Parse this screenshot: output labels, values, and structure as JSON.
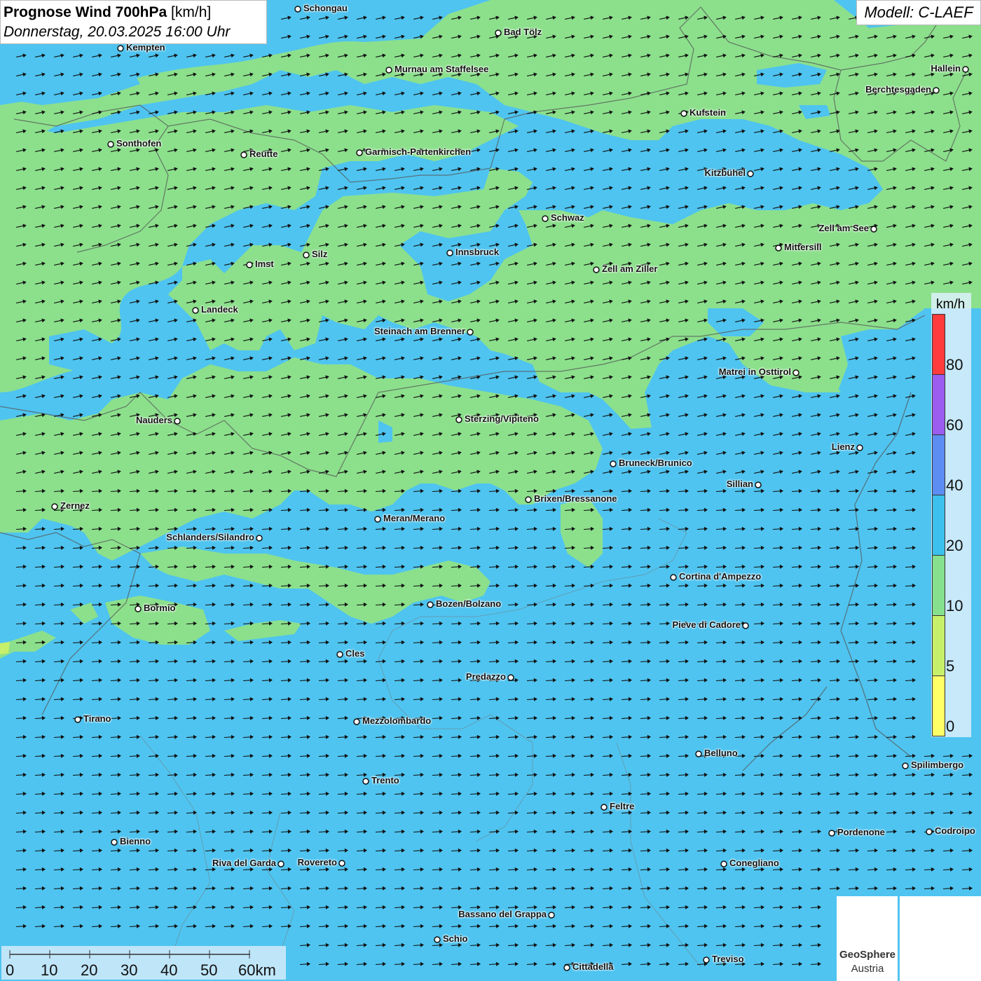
{
  "header": {
    "title_bold": "Prognose Wind 700hPa",
    "title_unit": "[km/h]",
    "datetime": "Donnerstag, 20.03.2025 16:00 Uhr",
    "model": "Modell: C-LAEF"
  },
  "legend": {
    "unit": "km/h",
    "ticks": [
      "80",
      "60",
      "40",
      "20",
      "10",
      "5",
      "0"
    ],
    "colors": {
      "above_80": "#ff3b3b",
      "60_80": "#9b5cf0",
      "40_60": "#5b8df2",
      "20_40": "#3cc0ec",
      "10_20": "#86e08e",
      "5_10": "#c6f06a",
      "0_5": "#ffff66"
    }
  },
  "scalebar": {
    "ticks": [
      "0",
      "10",
      "20",
      "30",
      "40",
      "50",
      "60km"
    ]
  },
  "logo": {
    "name": "GeoSphere",
    "subtitle": "Austria",
    "icon": "geosphere-logo-icon",
    "second_icon": "cloud-arrow-icon"
  },
  "cities": [
    {
      "name": "Schongau"
    },
    {
      "name": "Bad Tölz"
    },
    {
      "name": "Kempten"
    },
    {
      "name": "Murnau am Staffelsee"
    },
    {
      "name": "Hallein"
    },
    {
      "name": "Berchtesgaden"
    },
    {
      "name": "Kufstein"
    },
    {
      "name": "Sonthofen"
    },
    {
      "name": "Reutte"
    },
    {
      "name": "Garmisch-Partenkirchen"
    },
    {
      "name": "Kitzbühel"
    },
    {
      "name": "Schwaz"
    },
    {
      "name": "Zell am See"
    },
    {
      "name": "Mittersill"
    },
    {
      "name": "Innsbruck"
    },
    {
      "name": "Imst"
    },
    {
      "name": "Silz"
    },
    {
      "name": "Zell am Ziller"
    },
    {
      "name": "Landeck"
    },
    {
      "name": "Steinach am Brenner"
    },
    {
      "name": "Matrei in Osttirol"
    },
    {
      "name": "Nauders"
    },
    {
      "name": "Sterzing/Vipiteno"
    },
    {
      "name": "Lienz"
    },
    {
      "name": "Bruneck/Brunico"
    },
    {
      "name": "Sillian"
    },
    {
      "name": "Zernez"
    },
    {
      "name": "Brixen/Bressanone"
    },
    {
      "name": "Meran/Merano"
    },
    {
      "name": "Schlanders/Silandro"
    },
    {
      "name": "Cortina d'Ampezzo"
    },
    {
      "name": "Bozen/Bolzano"
    },
    {
      "name": "Bormio"
    },
    {
      "name": "Pieve di Cadore"
    },
    {
      "name": "Cles"
    },
    {
      "name": "Predazzo"
    },
    {
      "name": "Tirano"
    },
    {
      "name": "Mezzolombardo"
    },
    {
      "name": "Belluno"
    },
    {
      "name": "Spilimbergo"
    },
    {
      "name": "Trento"
    },
    {
      "name": "Feltre"
    },
    {
      "name": "Pordenone"
    },
    {
      "name": "Codroipo"
    },
    {
      "name": "Bienno"
    },
    {
      "name": "Riva del Garda"
    },
    {
      "name": "Rovereto"
    },
    {
      "name": "Conegliano"
    },
    {
      "name": "Bassano del Grappa"
    },
    {
      "name": "Schio"
    },
    {
      "name": "Treviso"
    },
    {
      "name": "Cittadella"
    }
  ]
}
